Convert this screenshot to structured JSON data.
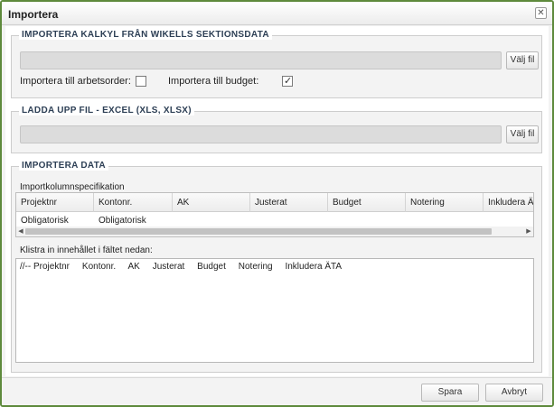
{
  "dialog": {
    "title": "Importera"
  },
  "section1": {
    "legend": "IMPORTERA KALKYL FRÅN WIKELLS SEKTIONSDATA",
    "browse_label": "Välj fil",
    "checkbox_workorder": {
      "label": "Importera till arbetsorder:",
      "checked": false
    },
    "checkbox_budget": {
      "label": "Importera till budget:",
      "checked": true
    }
  },
  "section2": {
    "legend": "LADDA UPP FIL - EXCEL (XLS, XLSX)",
    "browse_label": "Välj fil"
  },
  "section3": {
    "legend": "IMPORTERA DATA",
    "spec_label": "Importkolumnspecifikation",
    "columns": [
      "Projektnr",
      "Kontonr.",
      "AK",
      "Justerat",
      "Budget",
      "Notering",
      "Inkludera ÄTA"
    ],
    "row": [
      "Obligatorisk",
      "Obligatorisk",
      "",
      "",
      "",
      "",
      ""
    ],
    "paste_label": "Klistra in innehållet i fältet nedan:",
    "paste_content": "//-- Projektnr     Kontonr.     AK     Justerat     Budget     Notering     Inkludera ÄTA"
  },
  "footer": {
    "save_label": "Spara",
    "cancel_label": "Avbryt"
  }
}
